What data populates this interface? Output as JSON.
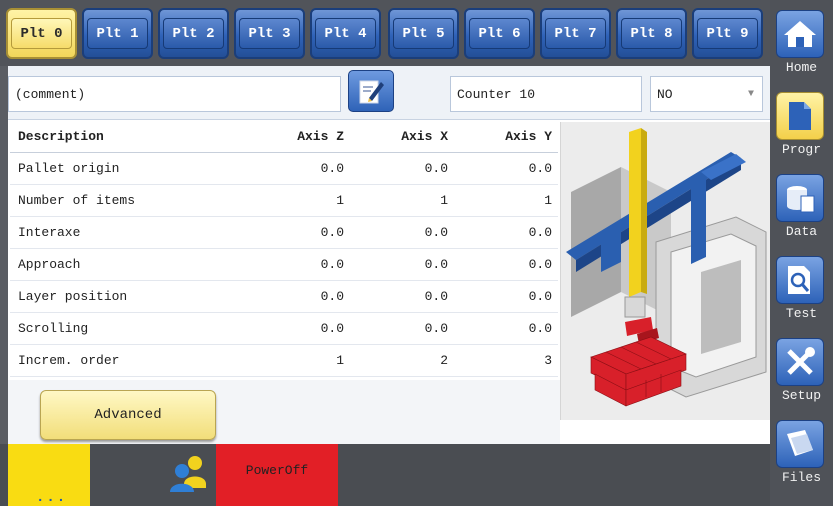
{
  "tabs": [
    "Plt 0",
    "Plt 1",
    "Plt 2",
    "Plt 3",
    "Plt 4",
    "Plt 5",
    "Plt 6",
    "Plt 7",
    "Plt 8",
    "Plt 9"
  ],
  "active_tab_index": 0,
  "comment": "(comment)",
  "counter": "Counter 10",
  "dropdown_value": "NO",
  "table": {
    "headers": [
      "Description",
      "Axis Z",
      "Axis X",
      "Axis Y"
    ],
    "rows": [
      [
        "Pallet origin",
        "0.0",
        "0.0",
        "0.0"
      ],
      [
        "Number of items",
        "1",
        "1",
        "1"
      ],
      [
        "Interaxe",
        "0.0",
        "0.0",
        "0.0"
      ],
      [
        "Approach",
        "0.0",
        "0.0",
        "0.0"
      ],
      [
        "Layer position",
        "0.0",
        "0.0",
        "0.0"
      ],
      [
        "Scrolling",
        "0.0",
        "0.0",
        "0.0"
      ],
      [
        "Increm. order",
        "1",
        "2",
        "3"
      ]
    ]
  },
  "advanced_label": "Advanced",
  "bottom": {
    "dots": "...",
    "power_label": "PowerOff"
  },
  "sidebar": [
    {
      "label": "Home",
      "icon": "home-icon"
    },
    {
      "label": "Progr",
      "icon": "document-icon"
    },
    {
      "label": "Data",
      "icon": "data-icon"
    },
    {
      "label": "Test",
      "icon": "test-icon"
    },
    {
      "label": "Setup",
      "icon": "tools-icon"
    },
    {
      "label": "Files",
      "icon": "files-icon"
    }
  ],
  "active_sidebar_index": 1,
  "colors": {
    "accent_yellow": "#f9dc12",
    "blue": "#2f63b8",
    "power_red": "#e21f26"
  }
}
